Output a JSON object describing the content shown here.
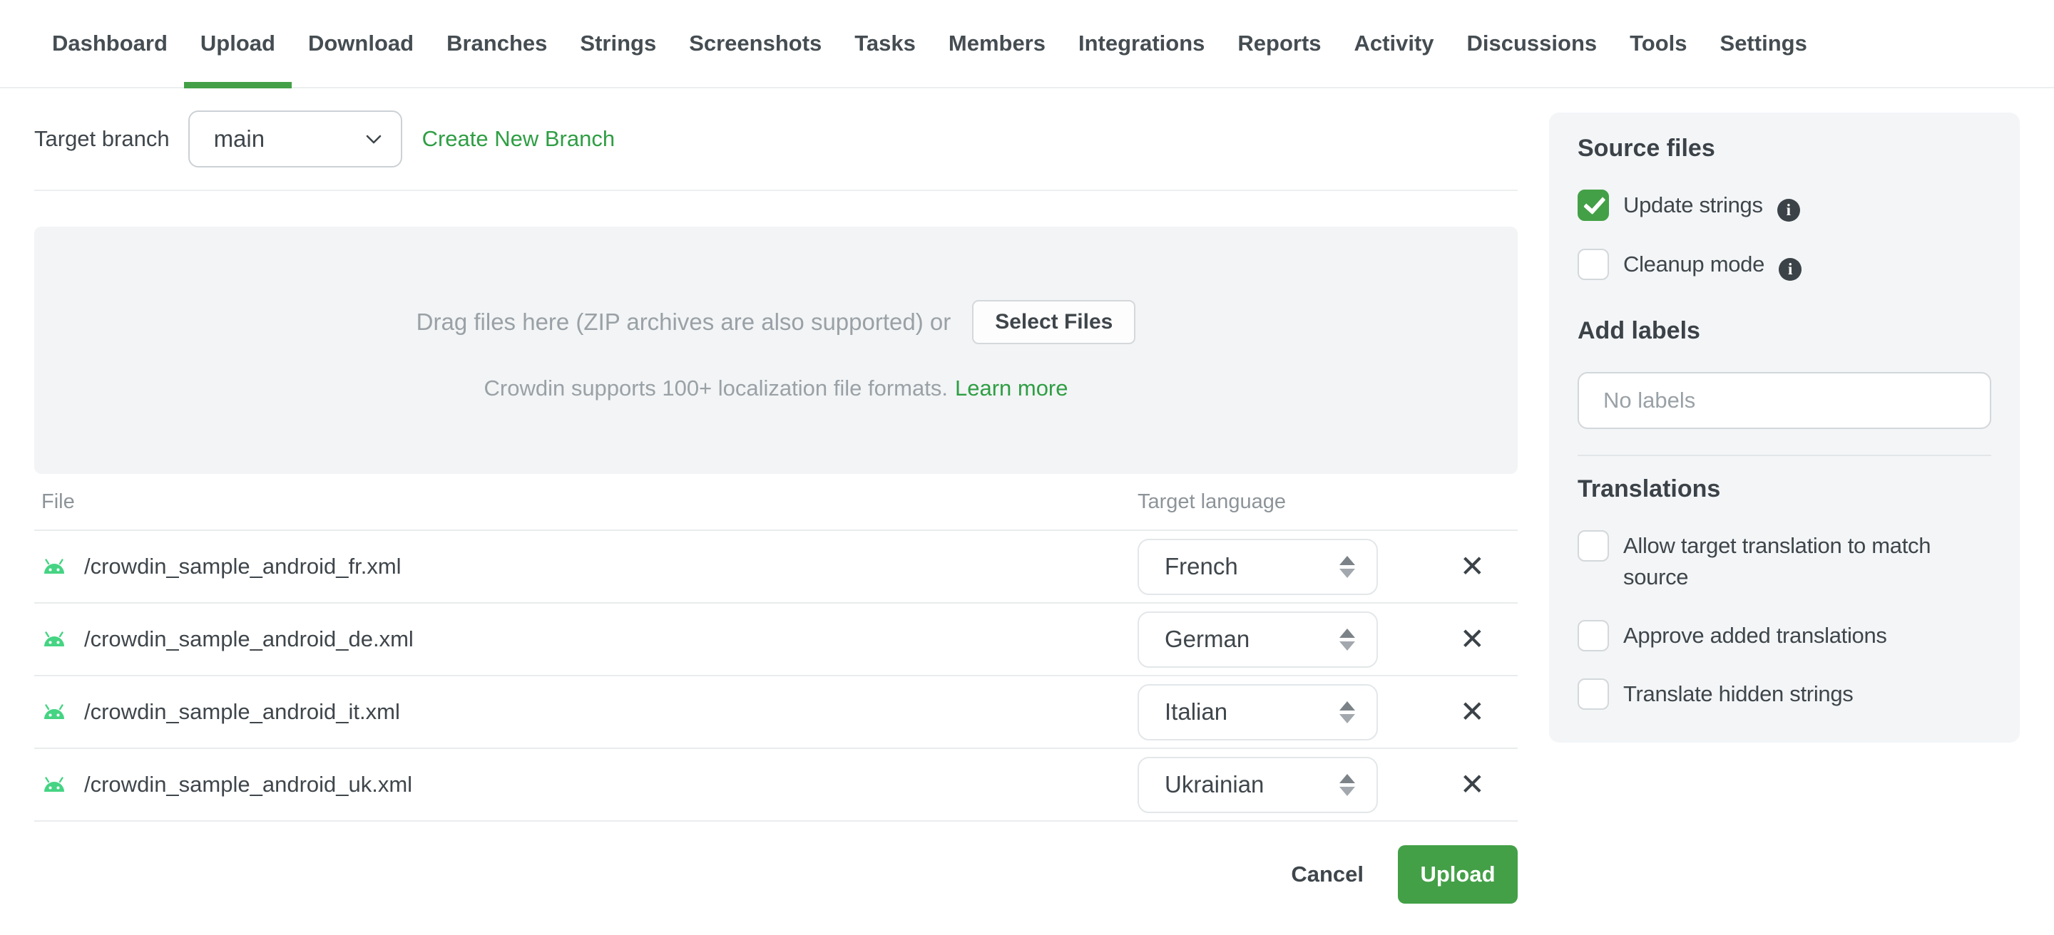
{
  "nav": {
    "items": [
      {
        "label": "Dashboard",
        "active": false
      },
      {
        "label": "Upload",
        "active": true
      },
      {
        "label": "Download",
        "active": false
      },
      {
        "label": "Branches",
        "active": false
      },
      {
        "label": "Strings",
        "active": false
      },
      {
        "label": "Screenshots",
        "active": false
      },
      {
        "label": "Tasks",
        "active": false
      },
      {
        "label": "Members",
        "active": false
      },
      {
        "label": "Integrations",
        "active": false
      },
      {
        "label": "Reports",
        "active": false
      },
      {
        "label": "Activity",
        "active": false
      },
      {
        "label": "Discussions",
        "active": false
      },
      {
        "label": "Tools",
        "active": false
      },
      {
        "label": "Settings",
        "active": false
      }
    ]
  },
  "branch_bar": {
    "label": "Target branch",
    "selected_branch": "main",
    "create_link": "Create New Branch"
  },
  "dropzone": {
    "drag_text": "Drag files here (ZIP archives are also supported) or",
    "select_button": "Select Files",
    "formats_text": "Crowdin supports 100+ localization file formats.",
    "learn_more": "Learn more"
  },
  "table": {
    "file_header": "File",
    "language_header": "Target language",
    "remove_glyph": "✕",
    "rows": [
      {
        "file": "/crowdin_sample_android_fr.xml",
        "language": "French"
      },
      {
        "file": "/crowdin_sample_android_de.xml",
        "language": "German"
      },
      {
        "file": "/crowdin_sample_android_it.xml",
        "language": "Italian"
      },
      {
        "file": "/crowdin_sample_android_uk.xml",
        "language": "Ukrainian"
      }
    ]
  },
  "footer": {
    "cancel": "Cancel",
    "upload": "Upload"
  },
  "sidebar": {
    "source_files": {
      "title": "Source files",
      "info_glyph": "i",
      "options": [
        {
          "label": "Update strings",
          "checked": true
        },
        {
          "label": "Cleanup mode",
          "checked": false
        }
      ]
    },
    "labels": {
      "title": "Add labels",
      "placeholder": "No labels"
    },
    "translations": {
      "title": "Translations",
      "options": [
        {
          "label": "Allow target translation to match source",
          "checked": false
        },
        {
          "label": "Approve added translations",
          "checked": false
        },
        {
          "label": "Translate hidden strings",
          "checked": false
        }
      ]
    }
  },
  "colors": {
    "accent_green": "#43a047",
    "link_green": "#2f9e44",
    "android_green": "#45d483",
    "text_dark": "#3f464b",
    "text_gray": "#9aa1a6"
  }
}
